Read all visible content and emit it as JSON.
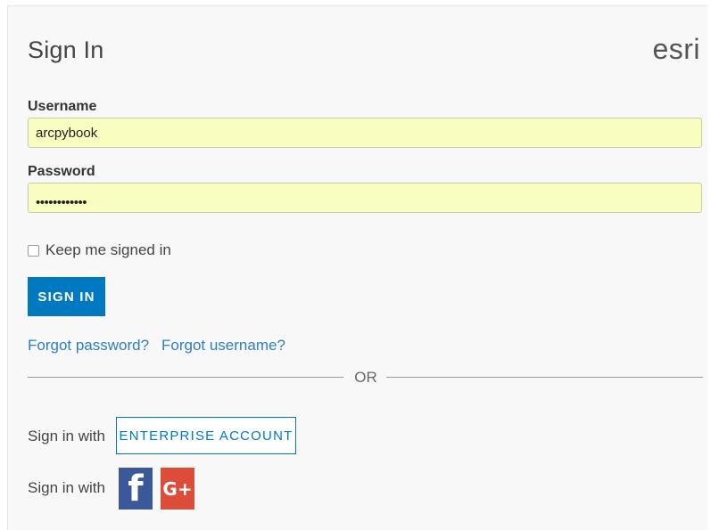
{
  "header": {
    "title": "Sign In",
    "logo": "esri"
  },
  "form": {
    "username_label": "Username",
    "username_value": "arcpybook",
    "password_label": "Password",
    "password_masked": "••••••••••••",
    "keep_signed_in_label": "Keep me signed in",
    "keep_signed_in_checked": false,
    "sign_in_button": "SIGN IN"
  },
  "links": {
    "forgot_password": "Forgot password?",
    "forgot_username": "Forgot username?"
  },
  "divider_text": "OR",
  "alt_signin": {
    "label_1": "Sign in with",
    "enterprise_button": "ENTERPRISE ACCOUNT",
    "label_2": "Sign in with",
    "facebook_glyph": "f",
    "google_glyph": "G+"
  },
  "colors": {
    "primary": "#0079c1",
    "autofill_bg": "#fafdc0",
    "facebook": "#3b5998",
    "google": "#dd4b39",
    "link": "#2e7fc0"
  },
  "icons": {
    "facebook": "facebook-icon",
    "google": "google-plus-icon",
    "checkbox": "checkbox"
  }
}
